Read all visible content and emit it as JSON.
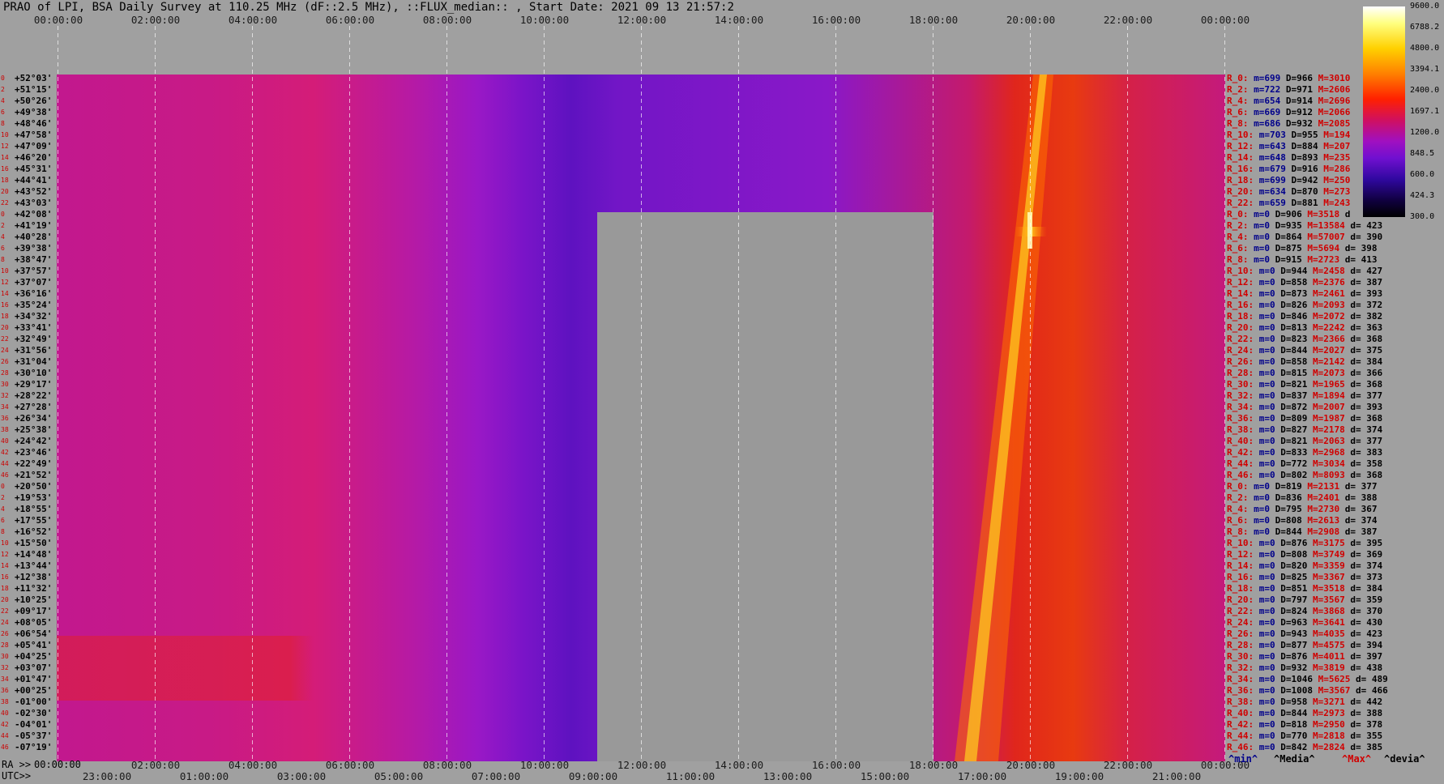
{
  "title": "PRAO of LPI, BSA Daily Survey at 110.25 MHz (dF::2.5 MHz), ::FLUX_median:: , Start Date: 2021 09 13 21:57:2",
  "axes": {
    "top_ticks": [
      "00:00:00",
      "02:00:00",
      "04:00:00",
      "06:00:00",
      "08:00:00",
      "10:00:00",
      "12:00:00",
      "14:00:00",
      "16:00:00",
      "18:00:00",
      "20:00:00",
      "22:00:00",
      "00:00:00"
    ],
    "ra_prefix": "RA >>",
    "utc_prefix": "UTC>>",
    "bottom_ra_ticks": [
      "00:00:00",
      "02:00:00",
      "04:00:00",
      "06:00:00",
      "08:00:00",
      "10:00:00",
      "12:00:00",
      "14:00:00",
      "16:00:00",
      "18:00:00",
      "20:00:00",
      "22:00:00",
      "00:00:00"
    ],
    "bottom_utc_ticks": [
      "23:00:00",
      "01:00:00",
      "03:00:00",
      "05:00:00",
      "07:00:00",
      "09:00:00",
      "11:00:00",
      "13:00:00",
      "15:00:00",
      "17:00:00",
      "19:00:00",
      "21:00:00"
    ]
  },
  "colorbar": {
    "ticks": [
      "9600.0",
      "6788.2",
      "4800.0",
      "3394.1",
      "2400.0",
      "1697.1",
      "1200.0",
      "848.5",
      "600.0",
      "424.3",
      "300.0"
    ]
  },
  "footer": {
    "min": "^min^",
    "median": "^Media^",
    "max": "^Max^",
    "dev": "^devia^"
  },
  "colors": {
    "background": "#a0a0a0",
    "masked": "#999999",
    "rowname": "#d00000",
    "min": "#00008b",
    "max": "#d00000"
  },
  "chart_data": {
    "type": "heatmap",
    "title": "PRAO of LPI, BSA Daily Survey at 110.25 MHz (dF::2.5 MHz), ::FLUX_median:: , Start Date: 2021 09 13 21:57:2",
    "xlabel": "RA / UTC",
    "colorscale": "black-blue-purple-red-orange-yellow-white (log)",
    "zlim": [
      300.0,
      9600.0
    ],
    "rows": [
      {
        "idx": "0",
        "dec": "+52°03'",
        "name": "R_0:",
        "min": "m=699",
        "med": "D=966",
        "max": "M=3010",
        "dev": ""
      },
      {
        "idx": "2",
        "dec": "+51°15'",
        "name": "R_2:",
        "min": "m=722",
        "med": "D=971",
        "max": "M=2606",
        "dev": ""
      },
      {
        "idx": "4",
        "dec": "+50°26'",
        "name": "R_4:",
        "min": "m=654",
        "med": "D=914",
        "max": "M=2696",
        "dev": ""
      },
      {
        "idx": "6",
        "dec": "+49°38'",
        "name": "R_6:",
        "min": "m=669",
        "med": "D=912",
        "max": "M=2066",
        "dev": ""
      },
      {
        "idx": "8",
        "dec": "+48°46'",
        "name": "R_8:",
        "min": "m=686",
        "med": "D=932",
        "max": "M=2085",
        "dev": ""
      },
      {
        "idx": "10",
        "dec": "+47°58'",
        "name": "R_10:",
        "min": "m=703",
        "med": "D=955",
        "max": "M=194",
        "dev": ""
      },
      {
        "idx": "12",
        "dec": "+47°09'",
        "name": "R_12:",
        "min": "m=643",
        "med": "D=884",
        "max": "M=207",
        "dev": ""
      },
      {
        "idx": "14",
        "dec": "+46°20'",
        "name": "R_14:",
        "min": "m=648",
        "med": "D=893",
        "max": "M=235",
        "dev": ""
      },
      {
        "idx": "16",
        "dec": "+45°31'",
        "name": "R_16:",
        "min": "m=679",
        "med": "D=916",
        "max": "M=286",
        "dev": ""
      },
      {
        "idx": "18",
        "dec": "+44°41'",
        "name": "R_18:",
        "min": "m=699",
        "med": "D=942",
        "max": "M=250",
        "dev": ""
      },
      {
        "idx": "20",
        "dec": "+43°52'",
        "name": "R_20:",
        "min": "m=634",
        "med": "D=870",
        "max": "M=273",
        "dev": ""
      },
      {
        "idx": "22",
        "dec": "+43°03'",
        "name": "R_22:",
        "min": "m=659",
        "med": "D=881",
        "max": "M=243",
        "dev": ""
      },
      {
        "idx": "0",
        "dec": "+42°08'",
        "name": "R_0:",
        "min": "m=0",
        "med": "D=906",
        "max": "M=3518",
        "dev": "d"
      },
      {
        "idx": "2",
        "dec": "+41°19'",
        "name": "R_2:",
        "min": "m=0",
        "med": "D=935",
        "max": "M=13584",
        "dev": "d= 423"
      },
      {
        "idx": "4",
        "dec": "+40°28'",
        "name": "R_4:",
        "min": "m=0",
        "med": "D=864",
        "max": "M=57007",
        "dev": "d= 390"
      },
      {
        "idx": "6",
        "dec": "+39°38'",
        "name": "R_6:",
        "min": "m=0",
        "med": "D=875",
        "max": "M=5694",
        "dev": "d= 398"
      },
      {
        "idx": "8",
        "dec": "+38°47'",
        "name": "R_8:",
        "min": "m=0",
        "med": "D=915",
        "max": "M=2723",
        "dev": "d= 413"
      },
      {
        "idx": "10",
        "dec": "+37°57'",
        "name": "R_10:",
        "min": "m=0",
        "med": "D=944",
        "max": "M=2458",
        "dev": "d= 427"
      },
      {
        "idx": "12",
        "dec": "+37°07'",
        "name": "R_12:",
        "min": "m=0",
        "med": "D=858",
        "max": "M=2376",
        "dev": "d= 387"
      },
      {
        "idx": "14",
        "dec": "+36°16'",
        "name": "R_14:",
        "min": "m=0",
        "med": "D=873",
        "max": "M=2461",
        "dev": "d= 393"
      },
      {
        "idx": "16",
        "dec": "+35°24'",
        "name": "R_16:",
        "min": "m=0",
        "med": "D=826",
        "max": "M=2093",
        "dev": "d= 372"
      },
      {
        "idx": "18",
        "dec": "+34°32'",
        "name": "R_18:",
        "min": "m=0",
        "med": "D=846",
        "max": "M=2072",
        "dev": "d= 382"
      },
      {
        "idx": "20",
        "dec": "+33°41'",
        "name": "R_20:",
        "min": "m=0",
        "med": "D=813",
        "max": "M=2242",
        "dev": "d= 363"
      },
      {
        "idx": "22",
        "dec": "+32°49'",
        "name": "R_22:",
        "min": "m=0",
        "med": "D=823",
        "max": "M=2366",
        "dev": "d= 368"
      },
      {
        "idx": "24",
        "dec": "+31°56'",
        "name": "R_24:",
        "min": "m=0",
        "med": "D=844",
        "max": "M=2027",
        "dev": "d= 375"
      },
      {
        "idx": "26",
        "dec": "+31°04'",
        "name": "R_26:",
        "min": "m=0",
        "med": "D=858",
        "max": "M=2142",
        "dev": "d= 384"
      },
      {
        "idx": "28",
        "dec": "+30°10'",
        "name": "R_28:",
        "min": "m=0",
        "med": "D=815",
        "max": "M=2073",
        "dev": "d= 366"
      },
      {
        "idx": "30",
        "dec": "+29°17'",
        "name": "R_30:",
        "min": "m=0",
        "med": "D=821",
        "max": "M=1965",
        "dev": "d= 368"
      },
      {
        "idx": "32",
        "dec": "+28°22'",
        "name": "R_32:",
        "min": "m=0",
        "med": "D=837",
        "max": "M=1894",
        "dev": "d= 377"
      },
      {
        "idx": "34",
        "dec": "+27°28'",
        "name": "R_34:",
        "min": "m=0",
        "med": "D=872",
        "max": "M=2007",
        "dev": "d= 393"
      },
      {
        "idx": "36",
        "dec": "+26°34'",
        "name": "R_36:",
        "min": "m=0",
        "med": "D=809",
        "max": "M=1987",
        "dev": "d= 368"
      },
      {
        "idx": "38",
        "dec": "+25°38'",
        "name": "R_38:",
        "min": "m=0",
        "med": "D=827",
        "max": "M=2178",
        "dev": "d= 374"
      },
      {
        "idx": "40",
        "dec": "+24°42'",
        "name": "R_40:",
        "min": "m=0",
        "med": "D=821",
        "max": "M=2063",
        "dev": "d= 377"
      },
      {
        "idx": "42",
        "dec": "+23°46'",
        "name": "R_42:",
        "min": "m=0",
        "med": "D=833",
        "max": "M=2968",
        "dev": "d= 383"
      },
      {
        "idx": "44",
        "dec": "+22°49'",
        "name": "R_44:",
        "min": "m=0",
        "med": "D=772",
        "max": "M=3034",
        "dev": "d= 358"
      },
      {
        "idx": "46",
        "dec": "+21°52'",
        "name": "R_46:",
        "min": "m=0",
        "med": "D=802",
        "max": "M=8093",
        "dev": "d= 368"
      },
      {
        "idx": "0",
        "dec": "+20°50'",
        "name": "R_0:",
        "min": "m=0",
        "med": "D=819",
        "max": "M=2131",
        "dev": "d= 377"
      },
      {
        "idx": "2",
        "dec": "+19°53'",
        "name": "R_2:",
        "min": "m=0",
        "med": "D=836",
        "max": "M=2401",
        "dev": "d= 388"
      },
      {
        "idx": "4",
        "dec": "+18°55'",
        "name": "R_4:",
        "min": "m=0",
        "med": "D=795",
        "max": "M=2730",
        "dev": "d= 367"
      },
      {
        "idx": "6",
        "dec": "+17°55'",
        "name": "R_6:",
        "min": "m=0",
        "med": "D=808",
        "max": "M=2613",
        "dev": "d= 374"
      },
      {
        "idx": "8",
        "dec": "+16°52'",
        "name": "R_8:",
        "min": "m=0",
        "med": "D=844",
        "max": "M=2908",
        "dev": "d= 387"
      },
      {
        "idx": "10",
        "dec": "+15°50'",
        "name": "R_10:",
        "min": "m=0",
        "med": "D=876",
        "max": "M=3175",
        "dev": "d= 395"
      },
      {
        "idx": "12",
        "dec": "+14°48'",
        "name": "R_12:",
        "min": "m=0",
        "med": "D=808",
        "max": "M=3749",
        "dev": "d= 369"
      },
      {
        "idx": "14",
        "dec": "+13°44'",
        "name": "R_14:",
        "min": "m=0",
        "med": "D=820",
        "max": "M=3359",
        "dev": "d= 374"
      },
      {
        "idx": "16",
        "dec": "+12°38'",
        "name": "R_16:",
        "min": "m=0",
        "med": "D=825",
        "max": "M=3367",
        "dev": "d= 373"
      },
      {
        "idx": "18",
        "dec": "+11°32'",
        "name": "R_18:",
        "min": "m=0",
        "med": "D=851",
        "max": "M=3518",
        "dev": "d= 384"
      },
      {
        "idx": "20",
        "dec": "+10°25'",
        "name": "R_20:",
        "min": "m=0",
        "med": "D=797",
        "max": "M=3567",
        "dev": "d= 359"
      },
      {
        "idx": "22",
        "dec": "+09°17'",
        "name": "R_22:",
        "min": "m=0",
        "med": "D=824",
        "max": "M=3868",
        "dev": "d= 370"
      },
      {
        "idx": "24",
        "dec": "+08°05'",
        "name": "R_24:",
        "min": "m=0",
        "med": "D=963",
        "max": "M=3641",
        "dev": "d= 430"
      },
      {
        "idx": "26",
        "dec": "+06°54'",
        "name": "R_26:",
        "min": "m=0",
        "med": "D=943",
        "max": "M=4035",
        "dev": "d= 423"
      },
      {
        "idx": "28",
        "dec": "+05°41'",
        "name": "R_28:",
        "min": "m=0",
        "med": "D=877",
        "max": "M=4575",
        "dev": "d= 394"
      },
      {
        "idx": "30",
        "dec": "+04°25'",
        "name": "R_30:",
        "min": "m=0",
        "med": "D=876",
        "max": "M=4011",
        "dev": "d= 397"
      },
      {
        "idx": "32",
        "dec": "+03°07'",
        "name": "R_32:",
        "min": "m=0",
        "med": "D=932",
        "max": "M=3819",
        "dev": "d= 438"
      },
      {
        "idx": "34",
        "dec": "+01°47'",
        "name": "R_34:",
        "min": "m=0",
        "med": "D=1046",
        "max": "M=5625",
        "dev": "d= 489"
      },
      {
        "idx": "36",
        "dec": "+00°25'",
        "name": "R_36:",
        "min": "m=0",
        "med": "D=1008",
        "max": "M=3567",
        "dev": "d= 466"
      },
      {
        "idx": "38",
        "dec": "-01°00'",
        "name": "R_38:",
        "min": "m=0",
        "med": "D=958",
        "max": "M=3271",
        "dev": "d= 442"
      },
      {
        "idx": "40",
        "dec": "-02°30'",
        "name": "R_40:",
        "min": "m=0",
        "med": "D=844",
        "max": "M=2973",
        "dev": "d= 388"
      },
      {
        "idx": "42",
        "dec": "-04°01'",
        "name": "R_42:",
        "min": "m=0",
        "med": "D=818",
        "max": "M=2950",
        "dev": "d= 378"
      },
      {
        "idx": "44",
        "dec": "-05°37'",
        "name": "R_44:",
        "min": "m=0",
        "med": "D=770",
        "max": "M=2818",
        "dev": "d= 355"
      },
      {
        "idx": "46",
        "dec": "-07°19'",
        "name": "R_46:",
        "min": "m=0",
        "med": "D=842",
        "max": "M=2824",
        "dev": "d= 385"
      }
    ]
  }
}
